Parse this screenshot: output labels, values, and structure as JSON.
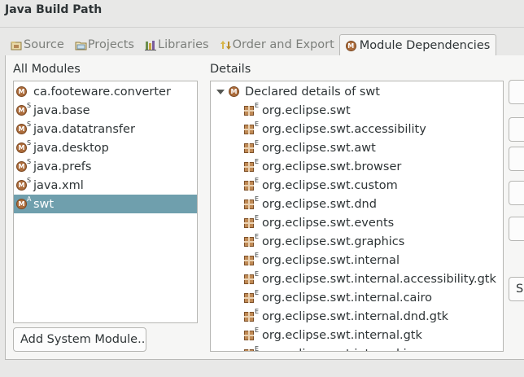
{
  "window": {
    "title": "Java Build Path"
  },
  "tabs": [
    {
      "label": "Source",
      "icon": "source-folder-icon",
      "active": false
    },
    {
      "label": "Projects",
      "icon": "projects-folder-icon",
      "active": false
    },
    {
      "label": "Libraries",
      "icon": "libraries-icon",
      "active": false
    },
    {
      "label": "Order and Export",
      "icon": "order-export-icon",
      "active": false
    },
    {
      "label": "Module Dependencies",
      "icon": "module-icon",
      "active": true
    }
  ],
  "all_modules": {
    "label": "All Modules",
    "items": [
      {
        "name": "ca.footeware.converter",
        "badge": "",
        "selected": false
      },
      {
        "name": "java.base",
        "badge": "S",
        "selected": false
      },
      {
        "name": "java.datatransfer",
        "badge": "S",
        "selected": false
      },
      {
        "name": "java.desktop",
        "badge": "S",
        "selected": false
      },
      {
        "name": "java.prefs",
        "badge": "S",
        "selected": false
      },
      {
        "name": "java.xml",
        "badge": "S",
        "selected": false
      },
      {
        "name": "swt",
        "badge": "A",
        "selected": true
      }
    ],
    "add_button": "Add System Module..."
  },
  "details": {
    "label": "Details",
    "root": "Declared details of swt",
    "packages": [
      "org.eclipse.swt",
      "org.eclipse.swt.accessibility",
      "org.eclipse.swt.awt",
      "org.eclipse.swt.browser",
      "org.eclipse.swt.custom",
      "org.eclipse.swt.dnd",
      "org.eclipse.swt.events",
      "org.eclipse.swt.graphics",
      "org.eclipse.swt.internal",
      "org.eclipse.swt.internal.accessibility.gtk",
      "org.eclipse.swt.internal.cairo",
      "org.eclipse.swt.internal.dnd.gtk",
      "org.eclipse.swt.internal.gtk",
      "org.eclipse.swt.internal.image"
    ],
    "package_badge": "E"
  },
  "side_buttons": [
    "",
    "",
    "",
    "",
    "",
    "S"
  ],
  "colors": {
    "selection": "#6f9fad",
    "module_icon": "#ad6d3c",
    "package_icon": "#c08a55"
  }
}
